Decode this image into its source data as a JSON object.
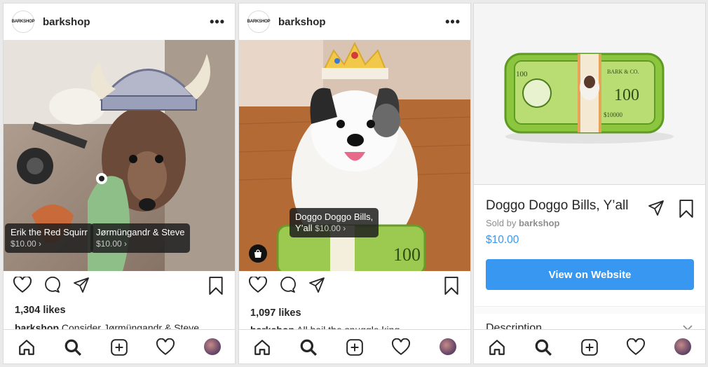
{
  "post1": {
    "username": "barkshop",
    "logo_text": "BARKSHOP",
    "tags": [
      {
        "name": "Erik the Red Squirr",
        "price": "$10.00 ›"
      },
      {
        "name": "Jørmüngandr & Steve",
        "price": "$10.00 ›"
      }
    ],
    "likes": "1,304 likes",
    "caption_user": "barkshop",
    "caption_text": " Consider Jørmüngandr & Steve"
  },
  "post2": {
    "username": "barkshop",
    "logo_text": "BARKSHOP",
    "tag": {
      "name": "Doggo Doggo Bills,",
      "name2": "Y’all",
      "price": "$10.00 ›"
    },
    "likes": "1,097 likes",
    "caption_user": "barkshop",
    "caption_text": " All hail the snuggle king"
  },
  "product": {
    "title": "Doggo Doggo Bills, Y’all",
    "sold_by_label": "Sold by ",
    "seller": "barkshop",
    "price": "$10.00",
    "cta": "View on Website",
    "description_label": "Description",
    "toy_text": "100",
    "toy_label": "$10000",
    "toy_bank": "BARK & CO."
  },
  "icons": {
    "nav": [
      "home-icon",
      "search-icon",
      "add-post-icon",
      "activity-heart-icon",
      "profile-avatar"
    ],
    "actions": [
      "like-heart-icon",
      "comment-icon",
      "share-icon",
      "bookmark-icon"
    ]
  },
  "colors": {
    "accent": "#3897f0",
    "text": "#262626",
    "muted": "#8e8e8e",
    "bill_green": "#8cc63f"
  }
}
